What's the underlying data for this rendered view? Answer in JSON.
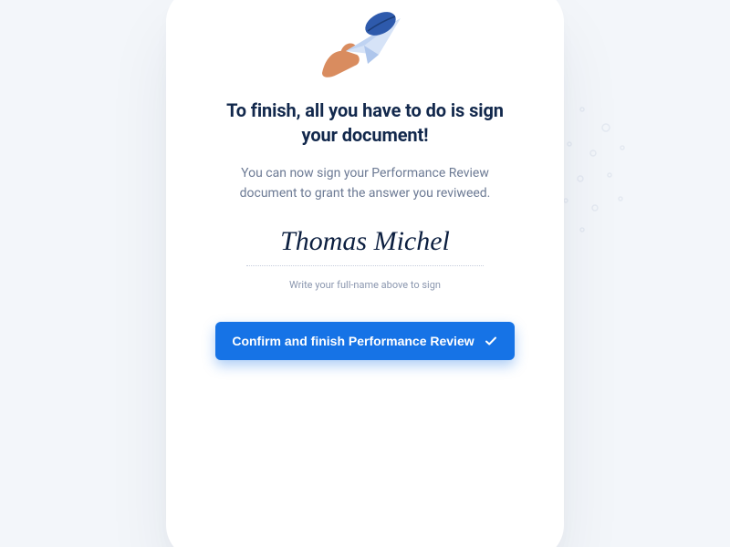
{
  "colors": {
    "bg": "#f3f6fa",
    "card": "#ffffff",
    "heading": "#12284C",
    "body": "#6C7A94",
    "hint": "#8A96AE",
    "dotted": "#C6CEDD",
    "primary": "#1673E6",
    "leaf": "#2E5AAC",
    "hand": "#D98C5F",
    "plane": "#BFD3F2"
  },
  "illustration": "hand-paper-plane-leaf",
  "title": "To finish, all you have to do is sign your document!",
  "subtitle": "You can now sign your Performance Review document to grant the answer you reviweed.",
  "signature": {
    "value": "Thomas Michel",
    "hint": "Write your full-name above to sign"
  },
  "confirm": {
    "label": "Confirm and finish Performance Review",
    "icon": "check-icon"
  }
}
